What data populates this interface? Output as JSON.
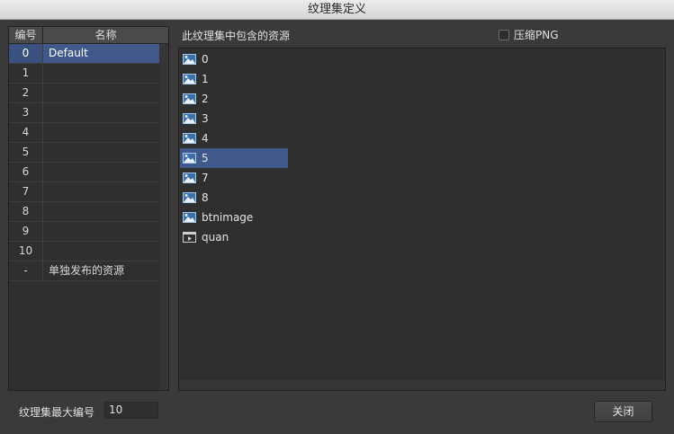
{
  "window": {
    "title": "纹理集定义"
  },
  "atlas_table": {
    "headers": {
      "num": "编号",
      "name": "名称"
    },
    "rows": [
      {
        "num": "0",
        "name": "Default",
        "selected": true
      },
      {
        "num": "1",
        "name": ""
      },
      {
        "num": "2",
        "name": ""
      },
      {
        "num": "3",
        "name": ""
      },
      {
        "num": "4",
        "name": ""
      },
      {
        "num": "5",
        "name": ""
      },
      {
        "num": "6",
        "name": ""
      },
      {
        "num": "7",
        "name": ""
      },
      {
        "num": "8",
        "name": ""
      },
      {
        "num": "9",
        "name": ""
      },
      {
        "num": "10",
        "name": ""
      },
      {
        "num": "-",
        "name": "单独发布的资源"
      }
    ]
  },
  "resources": {
    "label": "此纹理集中包含的资源",
    "compress_png": {
      "label": "压缩PNG",
      "checked": false
    },
    "items": [
      {
        "name": "0",
        "icon": "image-icon"
      },
      {
        "name": "1",
        "icon": "image-icon"
      },
      {
        "name": "2",
        "icon": "image-icon"
      },
      {
        "name": "3",
        "icon": "image-icon"
      },
      {
        "name": "4",
        "icon": "image-icon"
      },
      {
        "name": "5",
        "icon": "image-icon",
        "selected": true
      },
      {
        "name": "7",
        "icon": "image-icon"
      },
      {
        "name": "8",
        "icon": "image-icon"
      },
      {
        "name": "btnimage",
        "icon": "image-icon"
      },
      {
        "name": "quan",
        "icon": "movieclip-icon"
      }
    ]
  },
  "footer": {
    "max_label": "纹理集最大编号",
    "max_value": "10",
    "close_label": "关闭"
  }
}
